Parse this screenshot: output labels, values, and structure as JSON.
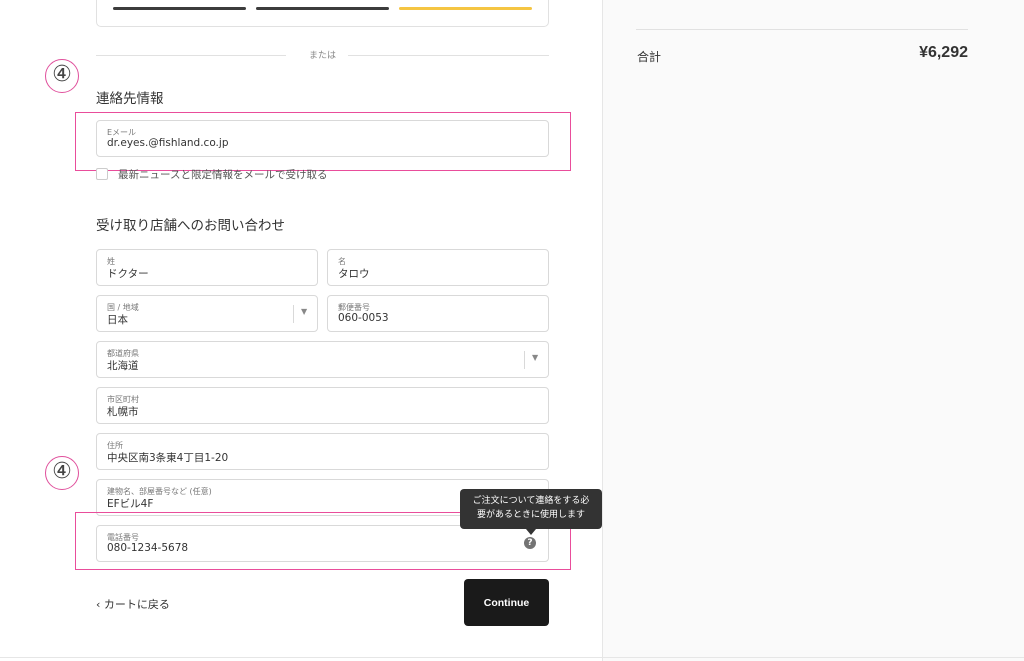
{
  "colors": {
    "accent_annotation": "#e94d9b",
    "button_dark": "#1a1a1a",
    "express_gold": "#f5c542",
    "panel_bg": "#fafafa"
  },
  "express": {
    "buttons": [
      "",
      "",
      ""
    ]
  },
  "divider": {
    "or_text": "または"
  },
  "annotations": {
    "step_number": "④"
  },
  "contact": {
    "section_title": "連絡先情報",
    "email": {
      "label": "Eメール",
      "value": "dr.eyes.@fishland.co.jp"
    },
    "newsletter_label": "最新ニュースと限定情報をメールで受け取る"
  },
  "pickup": {
    "section_title": "受け取り店舗へのお問い合わせ",
    "last_name": {
      "label": "姓",
      "value": "ドクター"
    },
    "first_name": {
      "label": "名",
      "value": "タロウ"
    },
    "country": {
      "label": "国 / 地域",
      "value": "日本"
    },
    "postal": {
      "label": "郵便番号",
      "value": "060-0053"
    },
    "prefecture": {
      "label": "都道府県",
      "value": "北海道"
    },
    "city": {
      "label": "市区町村",
      "value": "札幌市"
    },
    "address": {
      "label": "住所",
      "value": "中央区南3条東4丁目1-20"
    },
    "building": {
      "label": "建物名、部屋番号など (任意)",
      "value": "EFビル4F"
    },
    "phone": {
      "label": "電話番号",
      "value": "080-1234-5678"
    }
  },
  "tooltip": {
    "line1": "ご注文について連絡をする必",
    "line2": "要があるときに使用します"
  },
  "nav": {
    "back_label": "カートに戻る",
    "continue_label": "Continue"
  },
  "summary": {
    "total_label": "合計",
    "total_value": "¥6,292"
  }
}
